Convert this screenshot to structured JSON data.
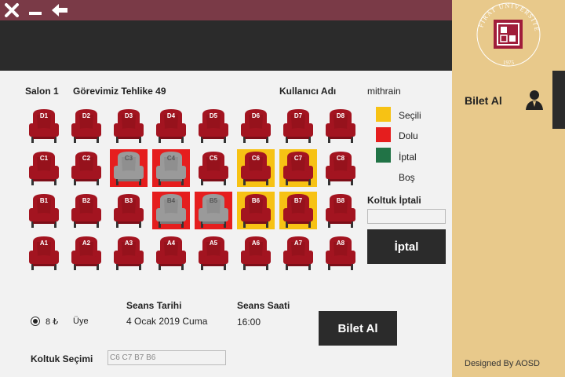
{
  "window": {
    "close_glyph": "✕",
    "minimize_glyph": "—",
    "back_glyph": "←"
  },
  "header": {
    "salon": "Salon 1",
    "movie": "Görevimiz Tehlike 49",
    "user_label": "Kullanıcı Adı",
    "username": "mithrain"
  },
  "legend": [
    {
      "label": "Seçili",
      "color": "#f7c214"
    },
    {
      "label": "Dolu",
      "color": "#e51e1e"
    },
    {
      "label": "İptal",
      "color": "#217346"
    },
    {
      "label": "Boş",
      "color": ""
    }
  ],
  "seats": [
    [
      {
        "code": "D1",
        "state": "empty"
      },
      {
        "code": "D2",
        "state": "empty"
      },
      {
        "code": "D3",
        "state": "empty"
      },
      {
        "code": "D4",
        "state": "empty"
      },
      {
        "code": "D5",
        "state": "empty"
      },
      {
        "code": "D6",
        "state": "empty"
      },
      {
        "code": "D7",
        "state": "empty"
      },
      {
        "code": "D8",
        "state": "empty"
      }
    ],
    [
      {
        "code": "C1",
        "state": "empty"
      },
      {
        "code": "C2",
        "state": "empty"
      },
      {
        "code": "C3",
        "state": "taken"
      },
      {
        "code": "C4",
        "state": "taken"
      },
      {
        "code": "C5",
        "state": "empty"
      },
      {
        "code": "C6",
        "state": "selected"
      },
      {
        "code": "C7",
        "state": "selected"
      },
      {
        "code": "C8",
        "state": "empty"
      }
    ],
    [
      {
        "code": "B1",
        "state": "empty"
      },
      {
        "code": "B2",
        "state": "empty"
      },
      {
        "code": "B3",
        "state": "empty"
      },
      {
        "code": "B4",
        "state": "taken"
      },
      {
        "code": "B5",
        "state": "taken"
      },
      {
        "code": "B6",
        "state": "selected"
      },
      {
        "code": "B7",
        "state": "selected"
      },
      {
        "code": "B8",
        "state": "empty"
      }
    ],
    [
      {
        "code": "A1",
        "state": "empty"
      },
      {
        "code": "A2",
        "state": "empty"
      },
      {
        "code": "A3",
        "state": "empty"
      },
      {
        "code": "A4",
        "state": "empty"
      },
      {
        "code": "A5",
        "state": "empty"
      },
      {
        "code": "A6",
        "state": "empty"
      },
      {
        "code": "A7",
        "state": "empty"
      },
      {
        "code": "A8",
        "state": "empty"
      }
    ]
  ],
  "cancel_panel": {
    "title": "Koltuk İptali",
    "input_value": "",
    "button": "İptal"
  },
  "pricing": {
    "price": "8 ₺",
    "type": "Üye"
  },
  "session": {
    "date_label": "Seans Tarihi",
    "date": "4 Ocak 2019 Cuma",
    "time_label": "Seans Saati",
    "time": "16:00"
  },
  "buy_button": "Bilet Al",
  "seat_selection": {
    "label": "Koltuk Seçimi",
    "value": "C6 C7 B7 B6"
  },
  "sidebar": {
    "bilet_al": "Bilet Al",
    "footer": "Designed By AOSD",
    "logo_text": "FIRAT ÜNİVERSİTESİ",
    "logo_year": "1975"
  },
  "colors": {
    "titlebar": "#7a3a47",
    "sidebar": "#e8c98b",
    "dark": "#2b2b2b",
    "seat_red": "#a31420"
  }
}
